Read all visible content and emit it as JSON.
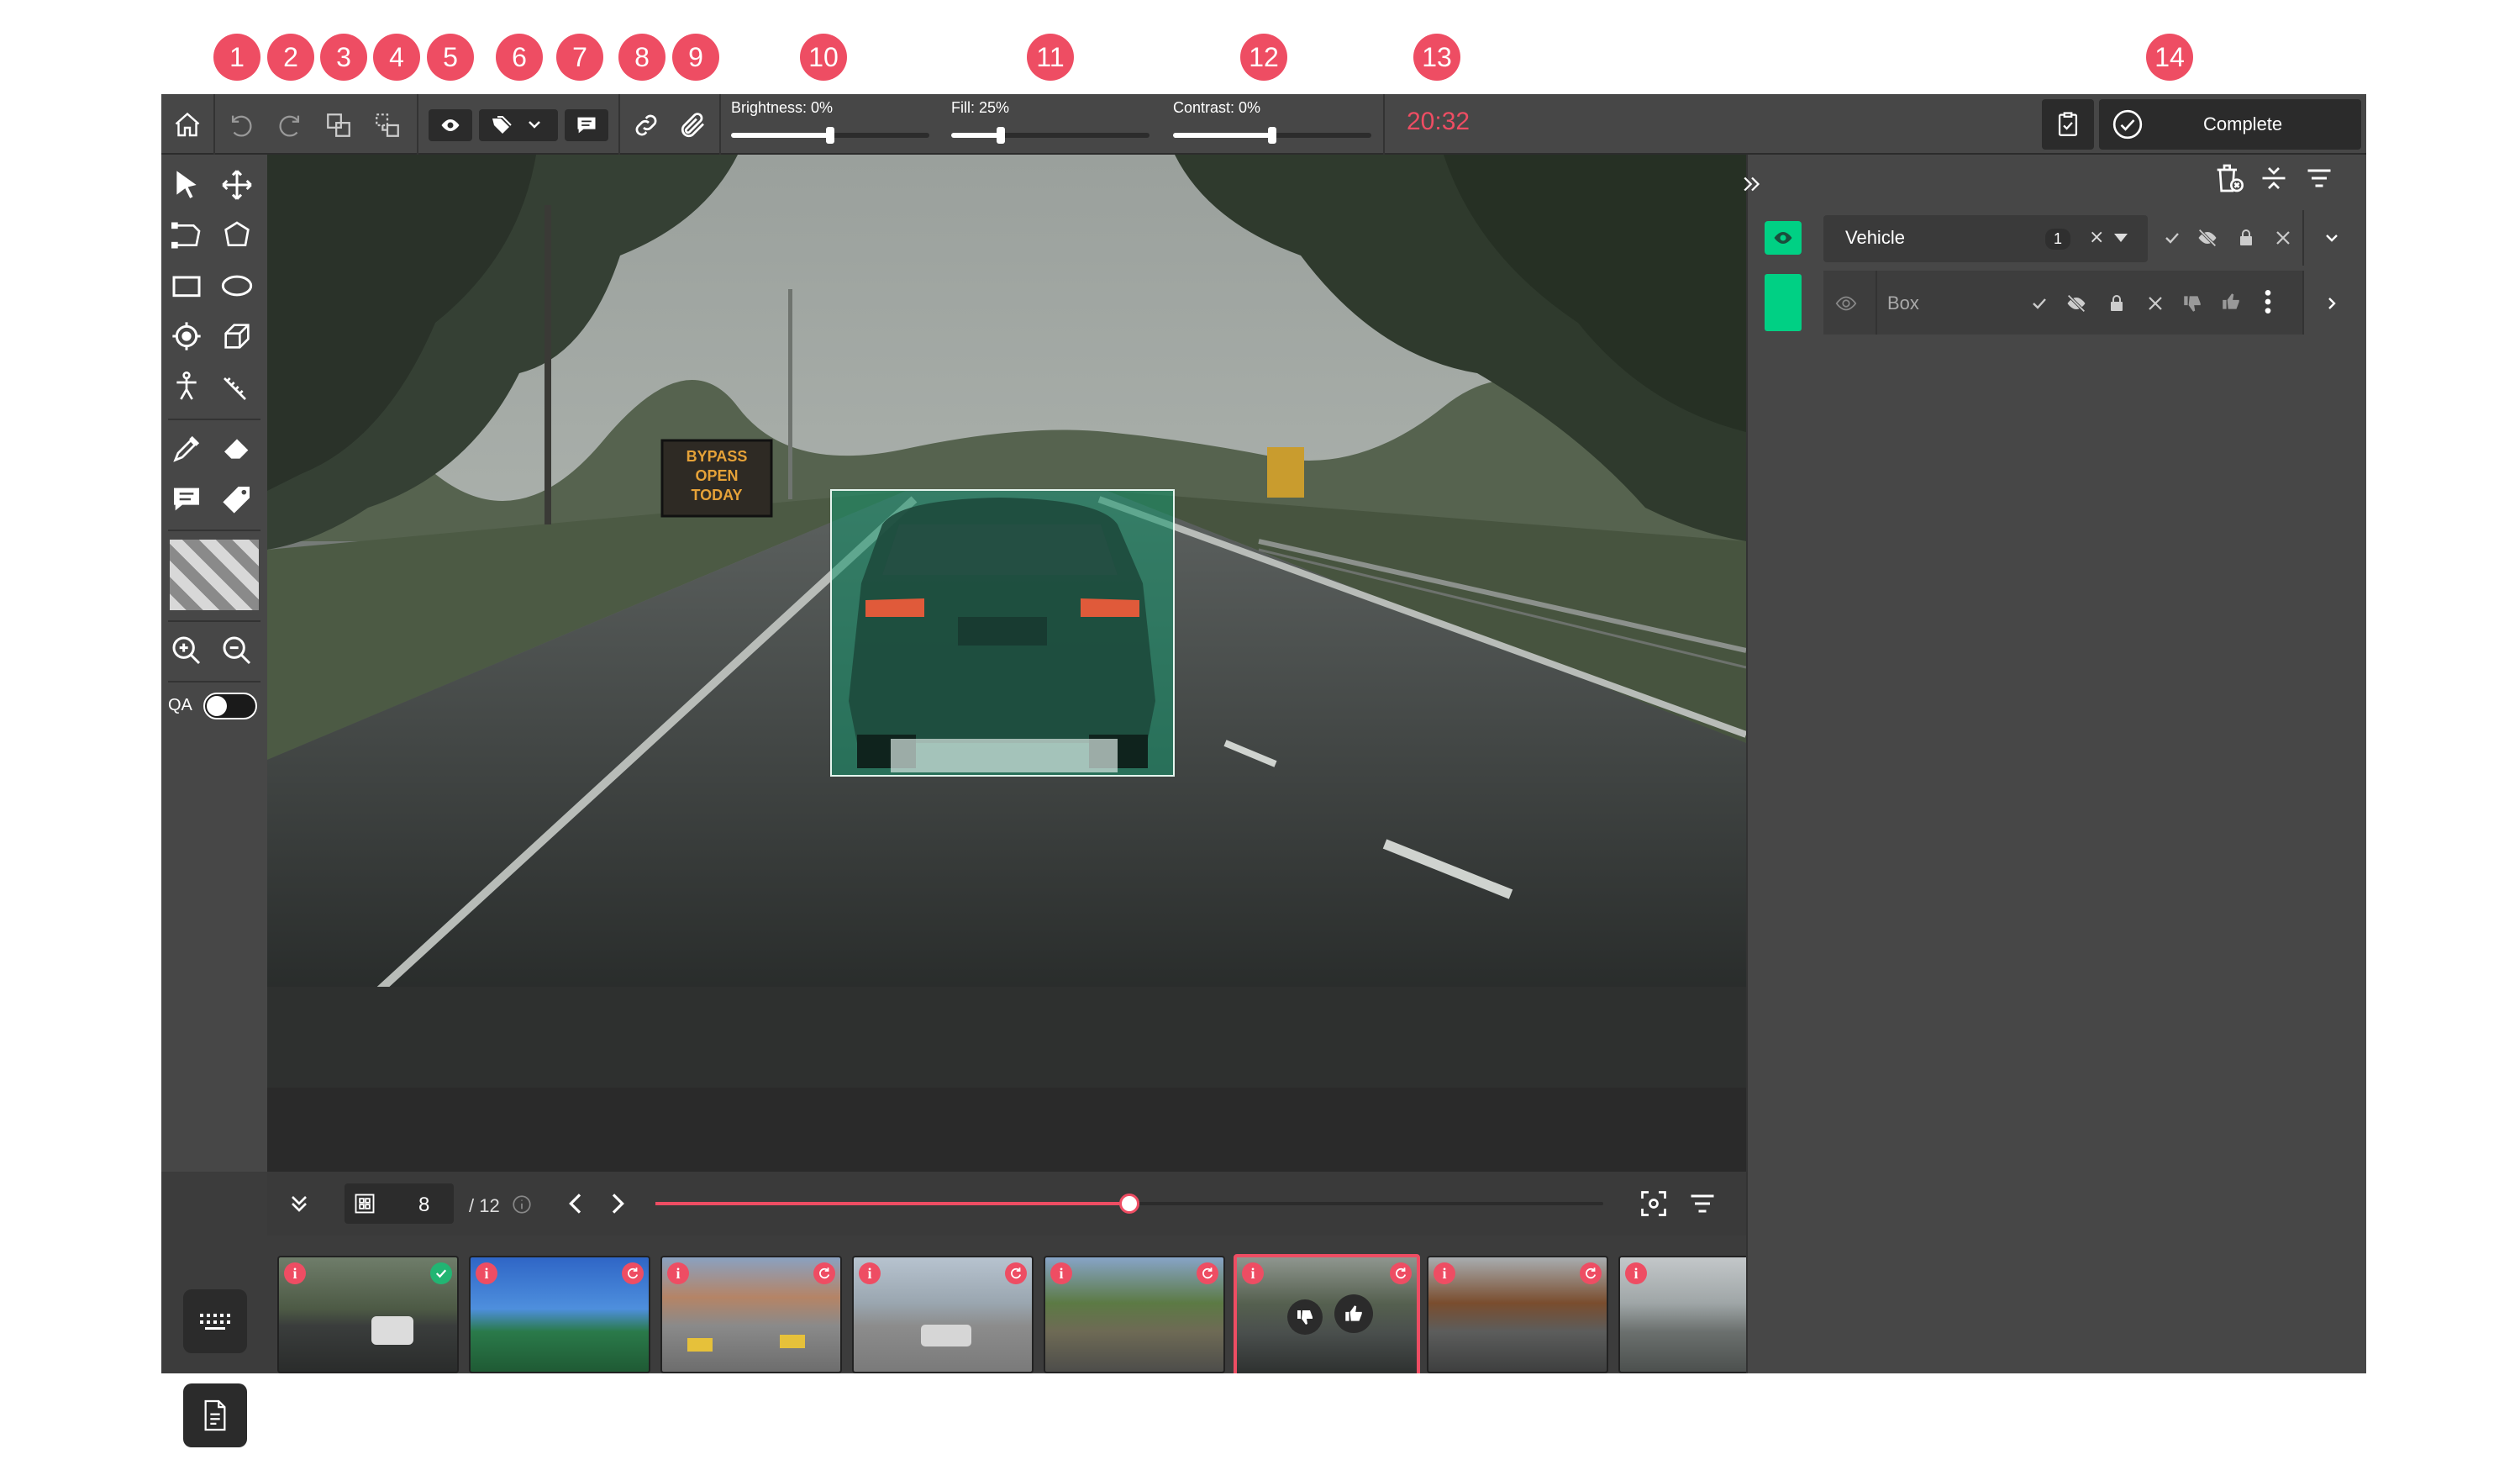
{
  "callouts": [
    "1",
    "2",
    "3",
    "4",
    "5",
    "6",
    "7",
    "8",
    "9",
    "10",
    "11",
    "12",
    "13",
    "14"
  ],
  "toolbar": {
    "brightness_label": "Brightness: 0%",
    "brightness_value": 0,
    "fill_label": "Fill: 25%",
    "fill_value": 25,
    "contrast_label": "Contrast: 0%",
    "contrast_value": 0,
    "timer": "20:32",
    "complete_label": "Complete"
  },
  "sign_text": [
    "BYPASS",
    "OPEN",
    "TODAY"
  ],
  "left_tools": {
    "qa_label": "QA",
    "qa_enabled": false
  },
  "annotation": {
    "label": "Box"
  },
  "navigation": {
    "current_frame": "8",
    "total_frames": "/ 12",
    "progress": 0.5
  },
  "panel": {
    "class_row": {
      "name": "Vehicle",
      "count": "1",
      "color": "#00d084"
    },
    "object_row": {
      "name": "Box",
      "color": "#00d084"
    }
  },
  "thumbnails": [
    {
      "status": "approved"
    },
    {
      "status": "pending"
    },
    {
      "status": "pending"
    },
    {
      "status": "pending"
    },
    {
      "status": "pending"
    },
    {
      "status": "pending",
      "active": true
    },
    {
      "status": "pending"
    },
    {
      "status": "none"
    }
  ],
  "colors": {
    "accent": "#ee4d63",
    "annotation": "#16966e",
    "success": "#22b573"
  }
}
